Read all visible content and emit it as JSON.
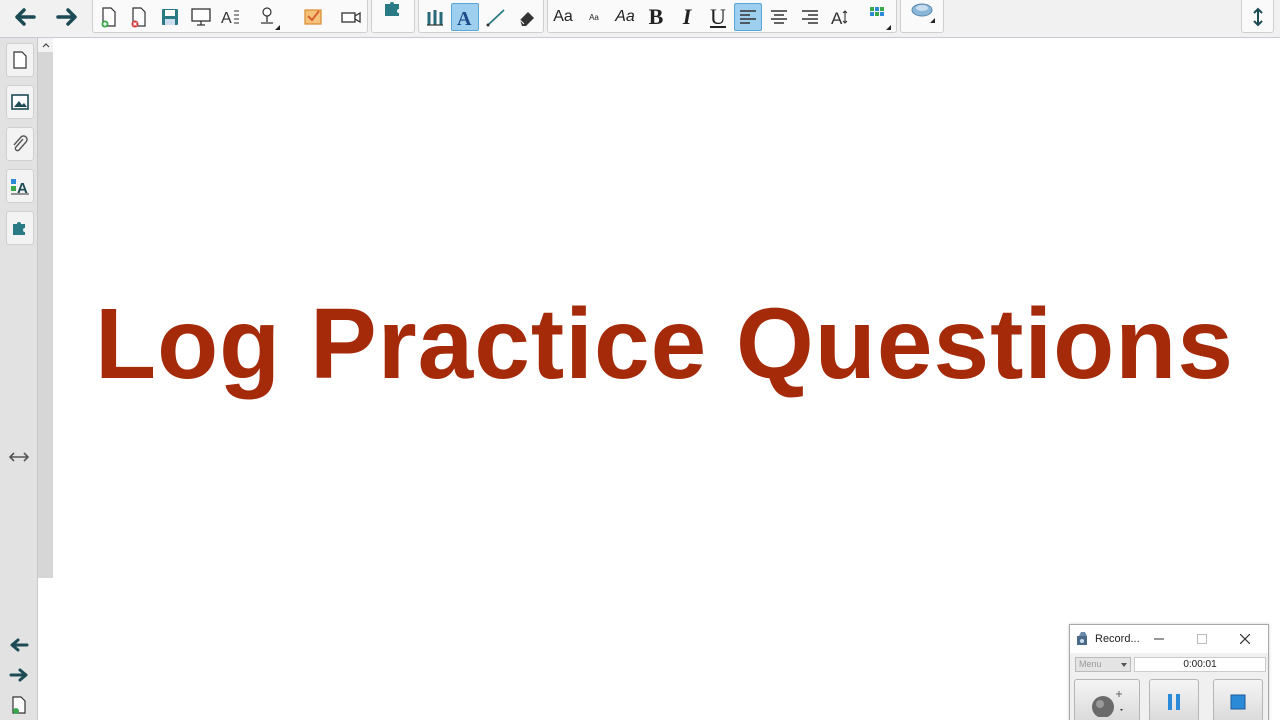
{
  "toolbar": {
    "font_sample_large": "Aa",
    "font_sample_small": "Aa",
    "font_sample_italic": "Aa",
    "bold_label": "B",
    "italic_label": "I",
    "underline_label": "U"
  },
  "canvas": {
    "title": "Log Practice Questions",
    "title_color": "#a52a0a"
  },
  "recorder": {
    "title": "Record...",
    "menu_label": "Menu",
    "elapsed_time": "0:00:01"
  },
  "icons": {
    "back": "arrow-left-icon",
    "forward": "arrow-right-icon",
    "new_page": "new-page-icon",
    "delete_page": "delete-page-icon",
    "save": "save-icon",
    "screen_shade": "screen-shade-icon",
    "spell": "spell-check-icon",
    "document_camera": "document-camera-icon",
    "response": "response-icon",
    "video": "video-camera-icon",
    "addons": "puzzle-icon",
    "pens": "pens-icon",
    "text": "text-tool-icon",
    "line": "line-tool-icon",
    "eraser": "eraser-icon",
    "align_left": "align-left-icon",
    "align_center": "align-center-icon",
    "align_right": "align-right-icon",
    "text_spacing": "text-spacing-icon",
    "table": "table-grid-icon",
    "shape": "shape-icon",
    "toolbar_move": "vertical-move-icon"
  },
  "colors": {
    "accent_active": "#9ecfee",
    "icon_teal": "#2a7a86",
    "title_red": "#a52a0a"
  }
}
